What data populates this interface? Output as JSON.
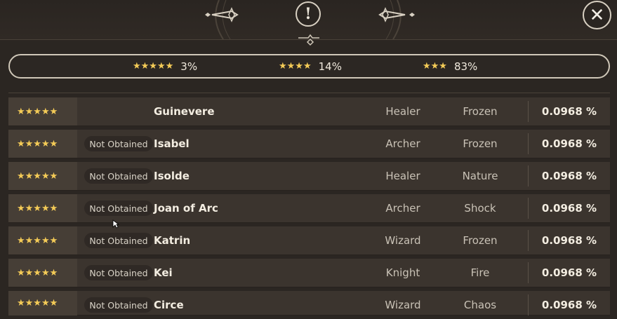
{
  "header": {
    "info_icon": "exclamation-icon",
    "close_icon": "close-icon",
    "info_label": "!",
    "close_label": "✕"
  },
  "summary": {
    "items": [
      {
        "stars": "★★★★★",
        "rate": "3%"
      },
      {
        "stars": "★★★★",
        "rate": "14%"
      },
      {
        "stars": "★★★",
        "rate": "83%"
      }
    ]
  },
  "rows": [
    {
      "stars": "★★★★★",
      "status": "",
      "name": "Guinevere",
      "class": "Healer",
      "attribute": "Frozen",
      "rate": "0.0968 %"
    },
    {
      "stars": "★★★★★",
      "status": "Not Obtained",
      "name": "Isabel",
      "class": "Archer",
      "attribute": "Frozen",
      "rate": "0.0968 %"
    },
    {
      "stars": "★★★★★",
      "status": "Not Obtained",
      "name": "Isolde",
      "class": "Healer",
      "attribute": "Nature",
      "rate": "0.0968 %"
    },
    {
      "stars": "★★★★★",
      "status": "Not Obtained",
      "name": "Joan of Arc",
      "class": "Archer",
      "attribute": "Shock",
      "rate": "0.0968 %"
    },
    {
      "stars": "★★★★★",
      "status": "Not Obtained",
      "name": "Katrin",
      "class": "Wizard",
      "attribute": "Frozen",
      "rate": "0.0968 %"
    },
    {
      "stars": "★★★★★",
      "status": "Not Obtained",
      "name": "Kei",
      "class": "Knight",
      "attribute": "Fire",
      "rate": "0.0968 %"
    },
    {
      "stars": "★★★★★",
      "status": "Not Obtained",
      "name": "Circe",
      "class": "Wizard",
      "attribute": "Chaos",
      "rate": "0.0968 %"
    }
  ],
  "colors": {
    "background": "#2b2622",
    "row": "#3b342e",
    "star": "#f4cb57",
    "border": "#cfc7b8"
  }
}
